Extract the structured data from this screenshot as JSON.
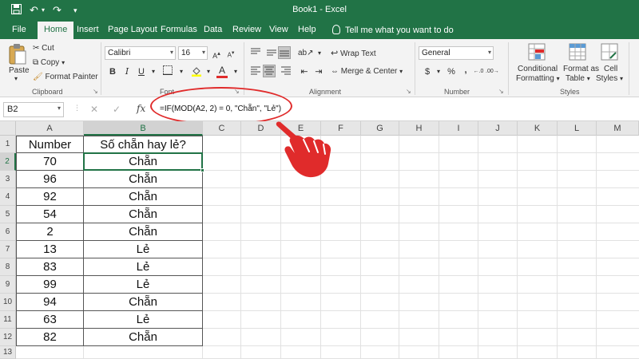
{
  "title_bar": {
    "document_title": "Book1 - Excel"
  },
  "tabs": [
    "File",
    "Home",
    "Insert",
    "Page Layout",
    "Formulas",
    "Data",
    "Review",
    "View",
    "Help"
  ],
  "tell_me": "Tell me what you want to do",
  "ribbon": {
    "clipboard": {
      "paste": "Paste",
      "cut": "Cut",
      "copy": "Copy",
      "format_painter": "Format Painter",
      "label": "Clipboard"
    },
    "font": {
      "name": "Calibri",
      "size": "16",
      "bold": "B",
      "italic": "I",
      "underline": "U",
      "font_color_letter": "A",
      "label": "Font",
      "accent_color": "#e02b2b"
    },
    "alignment": {
      "wrap_text": "Wrap Text",
      "merge_center": "Merge & Center",
      "label": "Alignment"
    },
    "number": {
      "format": "General",
      "currency": "$",
      "percent": "%",
      "comma": ",",
      "label": "Number"
    },
    "styles": {
      "conditional_formatting_1": "Conditional",
      "conditional_formatting_2": "Formatting",
      "format_as_table_1": "Format as",
      "format_as_table_2": "Table",
      "cell_styles_1": "Cell",
      "cell_styles_2": "Styles",
      "label": "Styles"
    }
  },
  "formula_bar": {
    "name_box": "B2",
    "fx": "fx",
    "formula": "=IF(MOD(A2, 2) = 0, \"Chẵn\", \"Lẻ\")"
  },
  "sheet": {
    "columns": [
      "A",
      "B",
      "C",
      "D",
      "E",
      "F",
      "G",
      "H",
      "I",
      "J",
      "K",
      "L",
      "M"
    ],
    "rows": [
      "1",
      "2",
      "3",
      "4",
      "5",
      "6",
      "7",
      "8",
      "9",
      "10",
      "11",
      "12",
      "13"
    ],
    "header": {
      "a": "Number",
      "b": "Số chẵn hay lẻ?"
    },
    "data": [
      {
        "a": "70",
        "b": "Chẵn"
      },
      {
        "a": "96",
        "b": "Chẵn"
      },
      {
        "a": "92",
        "b": "Chẵn"
      },
      {
        "a": "54",
        "b": "Chẵn"
      },
      {
        "a": "2",
        "b": "Chẵn"
      },
      {
        "a": "13",
        "b": "Lẻ"
      },
      {
        "a": "83",
        "b": "Lẻ"
      },
      {
        "a": "99",
        "b": "Lẻ"
      },
      {
        "a": "94",
        "b": "Chẵn"
      },
      {
        "a": "63",
        "b": "Lẻ"
      },
      {
        "a": "82",
        "b": "Chẵn"
      }
    ]
  },
  "colors": {
    "excel_green": "#217346",
    "annotation_red": "#e02b2b"
  },
  "icons": [
    "save-icon",
    "undo-icon",
    "redo-icon",
    "customize-qat-icon",
    "pointing-hand-icon"
  ]
}
